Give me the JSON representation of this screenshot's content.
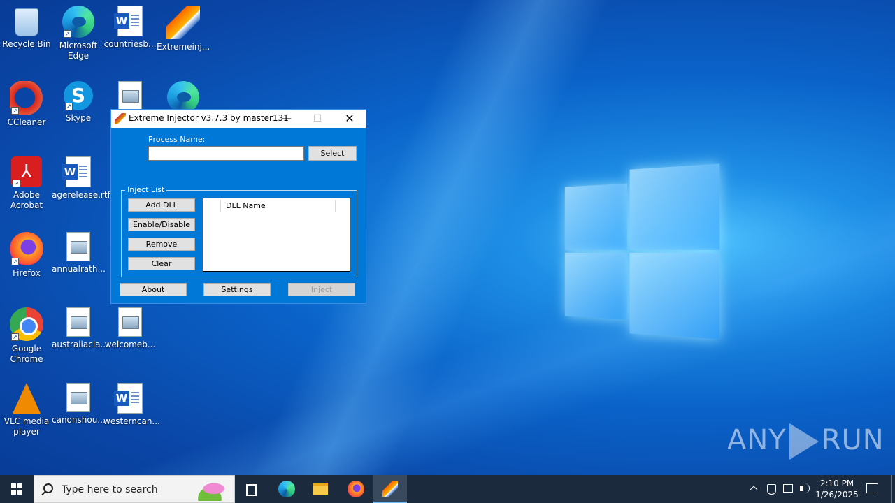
{
  "desktop": {
    "icons": [
      {
        "label": "Recycle Bin",
        "icon": "recycle-bin-icon"
      },
      {
        "label": "Microsoft Edge",
        "icon": "edge-icon"
      },
      {
        "label": "countriesb...",
        "icon": "word-document-icon"
      },
      {
        "label": "Extremeinj...",
        "icon": "extreme-injector-icon"
      },
      {
        "label": "CCleaner",
        "icon": "ccleaner-icon"
      },
      {
        "label": "Skype",
        "icon": "skype-icon"
      },
      {
        "label": "Adobe Acrobat",
        "icon": "acrobat-icon"
      },
      {
        "label": "agerelease.rtf",
        "icon": "word-document-icon"
      },
      {
        "label": "Firefox",
        "icon": "firefox-icon"
      },
      {
        "label": "annualrath...",
        "icon": "image-document-icon"
      },
      {
        "label": "Google Chrome",
        "icon": "chrome-icon"
      },
      {
        "label": "australiacla...",
        "icon": "image-document-icon"
      },
      {
        "label": "welcomeb...",
        "icon": "image-document-icon"
      },
      {
        "label": "VLC media player",
        "icon": "vlc-icon"
      },
      {
        "label": "canonshou...",
        "icon": "image-document-icon"
      },
      {
        "label": "westerncan...",
        "icon": "word-document-icon"
      }
    ]
  },
  "window": {
    "title": "Extreme Injector v3.7.3 by master131",
    "minimize_glyph": "—",
    "maximize_glyph": "☐",
    "close_glyph": "✕",
    "process_label": "Process Name:",
    "process_value": "",
    "select_button": "Select",
    "inject_group_label": "Inject List",
    "add_dll_button": "Add DLL",
    "enable_disable_button": "Enable/Disable",
    "remove_button": "Remove",
    "clear_button": "Clear",
    "dll_column_header": "DLL Name",
    "about_button": "About",
    "settings_button": "Settings",
    "inject_button": "Inject"
  },
  "taskbar": {
    "search_placeholder": "Type here to search",
    "time": "2:10 PM",
    "date": "1/26/2025"
  },
  "watermark": {
    "left": "ANY",
    "right": "RUN"
  },
  "colors": {
    "window_body": "#0078d7",
    "taskbar": "#1c2a3d"
  }
}
